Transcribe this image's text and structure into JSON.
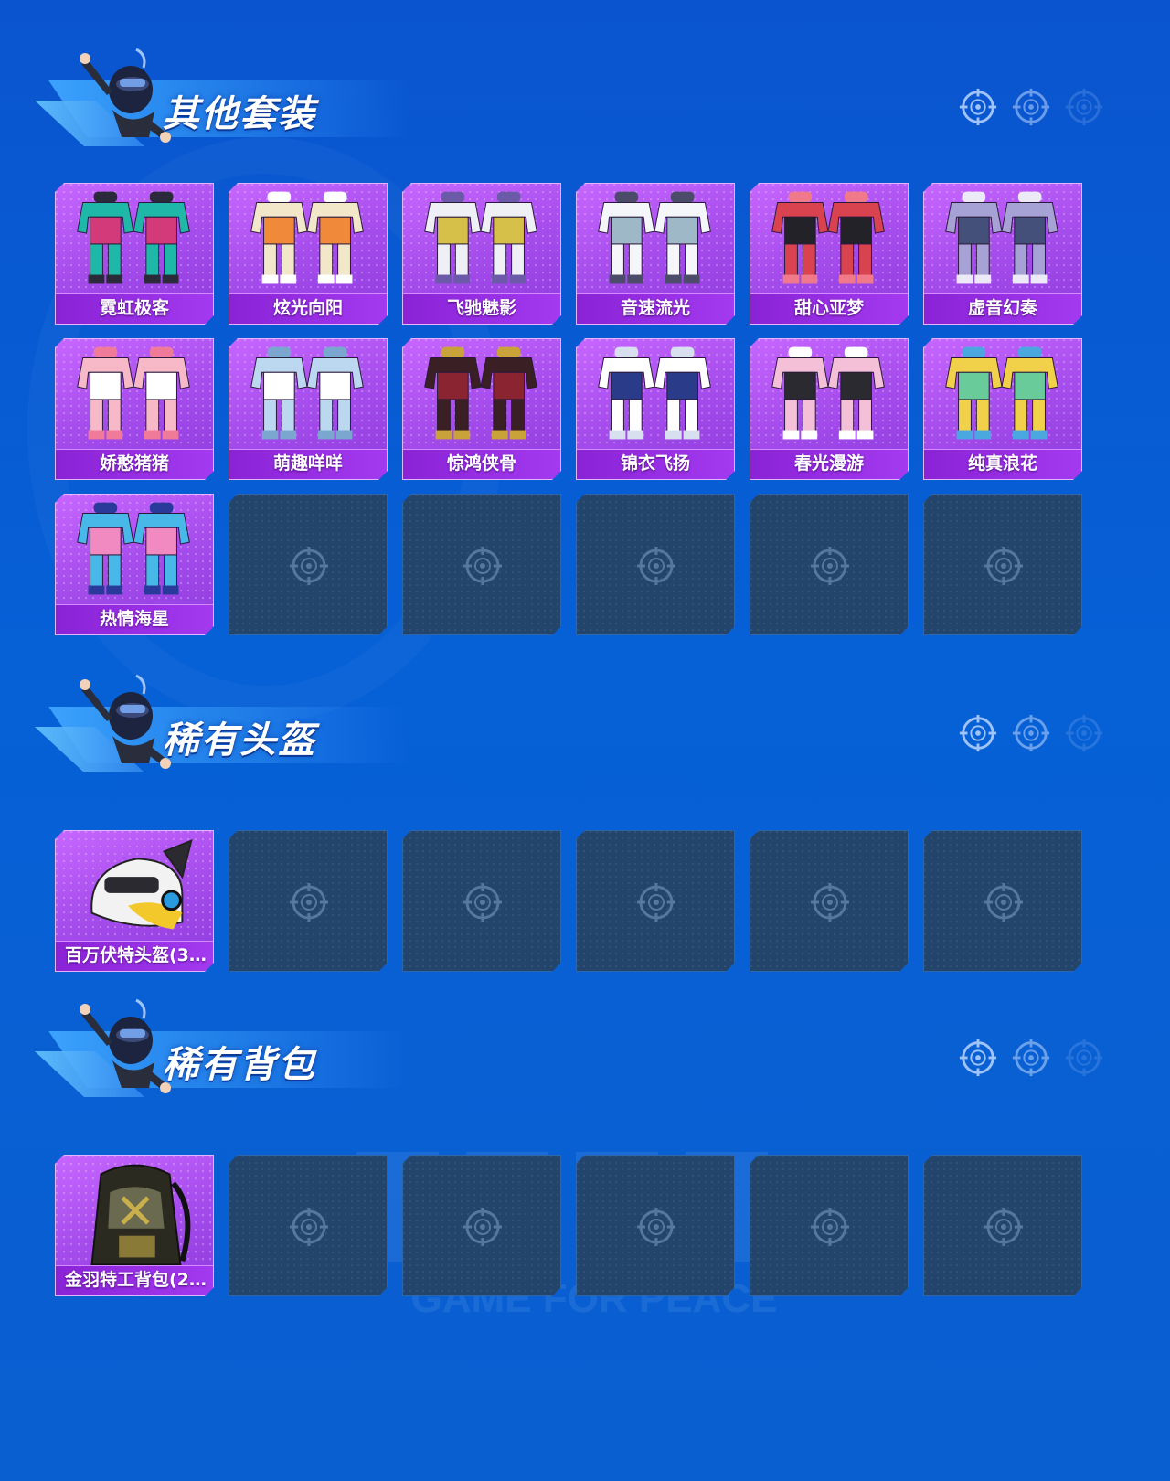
{
  "sections": [
    {
      "title": "其他套装",
      "items": [
        {
          "label": "霓虹极客",
          "palette": [
            "#1fb8a8",
            "#d23a7a",
            "#2a2a3a"
          ]
        },
        {
          "label": "炫光向阳",
          "palette": [
            "#f3e7c9",
            "#f08a3a",
            "#ffffff"
          ]
        },
        {
          "label": "飞驰魅影",
          "palette": [
            "#eef0f5",
            "#d7c04a",
            "#6a5aa8"
          ]
        },
        {
          "label": "音速流光",
          "palette": [
            "#f4f6fa",
            "#9fb8c8",
            "#4b4b6a"
          ]
        },
        {
          "label": "甜心亚梦",
          "palette": [
            "#d8434f",
            "#222228",
            "#f07a8a"
          ]
        },
        {
          "label": "虚音幻奏",
          "palette": [
            "#a7a2d6",
            "#45507a",
            "#eceaf7"
          ]
        },
        {
          "label": "娇憨猪猪",
          "palette": [
            "#f7b8c8",
            "#ffffff",
            "#f07a9a"
          ]
        },
        {
          "label": "萌趣咩咩",
          "palette": [
            "#bcd8f0",
            "#ffffff",
            "#7aa6d0"
          ]
        },
        {
          "label": "惊鸿侠骨",
          "palette": [
            "#3a1f24",
            "#8a2430",
            "#c9a23a"
          ]
        },
        {
          "label": "锦衣飞扬",
          "palette": [
            "#ffffff",
            "#2a3b8a",
            "#d8e0f0"
          ]
        },
        {
          "label": "春光漫游",
          "palette": [
            "#f3c0d8",
            "#2a2a30",
            "#ffffff"
          ]
        },
        {
          "label": "纯真浪花",
          "palette": [
            "#f2d14a",
            "#6acb9a",
            "#4aa7e0"
          ]
        },
        {
          "label": "热情海星",
          "palette": [
            "#48b8e8",
            "#f08ac0",
            "#2a3a9a"
          ]
        },
        {
          "label": ""
        },
        {
          "label": ""
        },
        {
          "label": ""
        },
        {
          "label": ""
        },
        {
          "label": ""
        }
      ]
    },
    {
      "title": "稀有头盔",
      "items": [
        {
          "label": "百万伏特头盔(3...",
          "palette": [
            "#f2f2f2",
            "#f2c82a",
            "#2a2a30"
          ]
        },
        {
          "label": ""
        },
        {
          "label": ""
        },
        {
          "label": ""
        },
        {
          "label": ""
        },
        {
          "label": ""
        }
      ]
    },
    {
      "title": "稀有背包",
      "items": [
        {
          "label": "金羽特工背包(2...",
          "palette": [
            "#2a2a20",
            "#6a6a50",
            "#c9b04a"
          ]
        },
        {
          "label": ""
        },
        {
          "label": ""
        },
        {
          "label": ""
        },
        {
          "label": ""
        },
        {
          "label": ""
        }
      ]
    }
  ],
  "watermark_text": "GAME FOR PEACE",
  "colors": {
    "background": "#0a5cd2",
    "card_filled": "#a54cec",
    "card_empty": "#23446b",
    "title_text": "#ffffff"
  }
}
